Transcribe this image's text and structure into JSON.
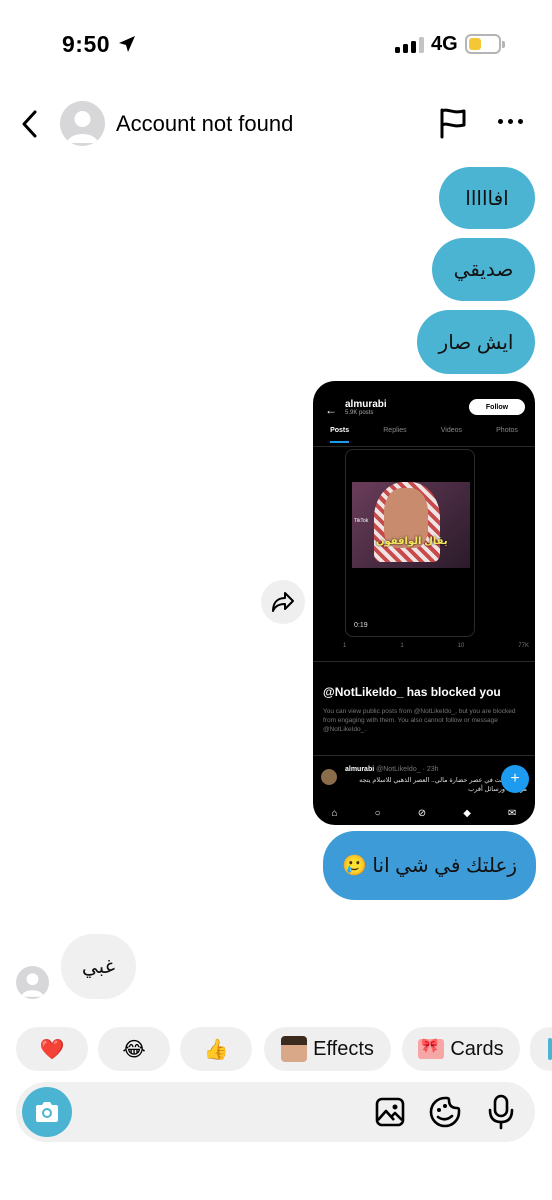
{
  "status_bar": {
    "time": "9:50",
    "network": "4G"
  },
  "header": {
    "title": "Account not found"
  },
  "messages": [
    {
      "direction": "out",
      "text": "افااااا"
    },
    {
      "direction": "out",
      "text": "صديقي"
    },
    {
      "direction": "out",
      "text": "ايش صار"
    },
    {
      "direction": "out",
      "type": "shared_post"
    },
    {
      "direction": "out",
      "text": "زعلتك في شي انا 🥲"
    },
    {
      "direction": "in",
      "text": "غبي"
    }
  ],
  "shared_post": {
    "account_name": "almurabi",
    "post_count": "5.9K posts",
    "follow_label": "Follow",
    "tabs": [
      "Posts",
      "Replies",
      "Videos",
      "Photos"
    ],
    "video_caption": "يقال الواقفون",
    "tiktok_label": "TikTok",
    "duration": "0:19",
    "action_counts": [
      "1",
      "1",
      "10",
      "77K"
    ],
    "blocked_title": "@NotLikeIdo_ has blocked you",
    "blocked_body": "You can view public posts from @NotLikeIdo_, but you are blocked from engaging with them. You also cannot follow or message @NotLikeIdo_.",
    "reply_author": "almurabi",
    "reply_handle": "@NotLikeIdo_ · 23h",
    "reply_text": "قرطبة كانت في عصر حضارة مالي.. العصر الذهبي للاسلام يتجه مؤلفات ورسائل أقرب"
  },
  "reactions": [
    {
      "emoji": "❤️"
    },
    {
      "emoji": "😂"
    },
    {
      "emoji": "👍"
    },
    {
      "label": "Effects"
    },
    {
      "label": "Cards"
    }
  ],
  "colors": {
    "outgoing_bubble": "#4bb4d3",
    "outgoing_bubble_dark": "#3d9bd8",
    "incoming_bubble": "#f0f0f1"
  }
}
